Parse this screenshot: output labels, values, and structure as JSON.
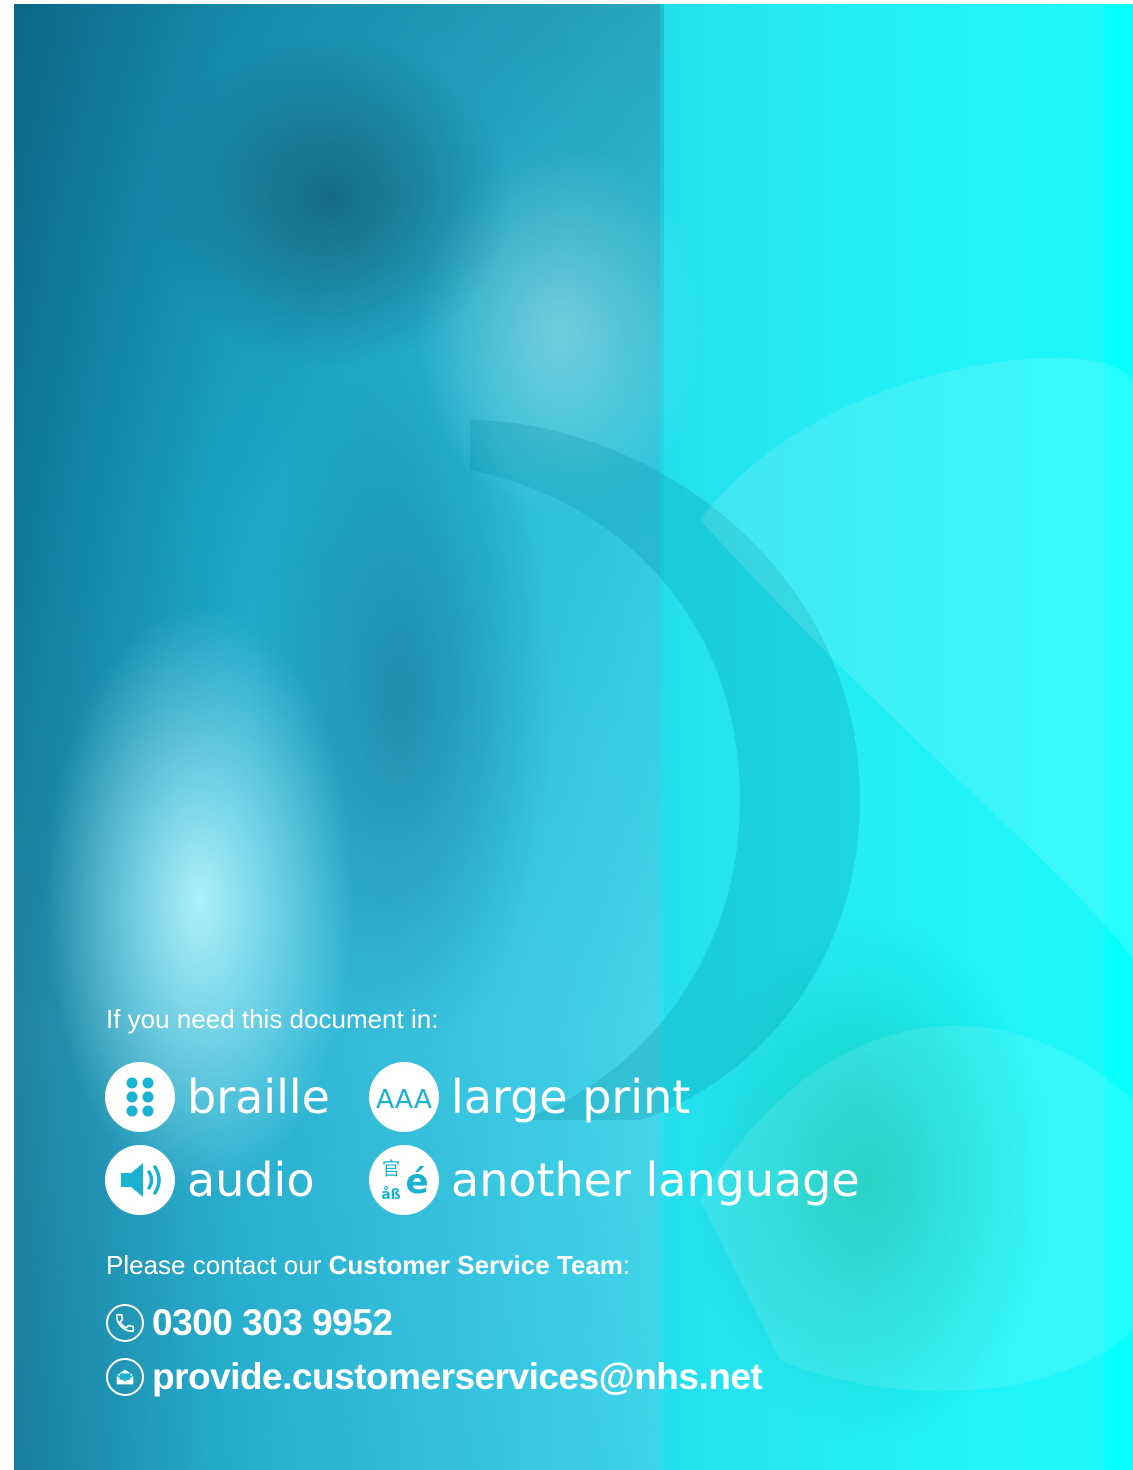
{
  "intro": "If you need this document in:",
  "formats": [
    {
      "label": "braille",
      "icon": "braille-icon"
    },
    {
      "label": "large print",
      "icon": "large-print-icon"
    },
    {
      "label": "audio",
      "icon": "audio-speaker-icon"
    },
    {
      "label": "another language",
      "icon": "language-icon"
    }
  ],
  "icon_text": {
    "large_print": "AAA",
    "language_top": "官",
    "language_bottom": "åß",
    "language_main": "é"
  },
  "contact": {
    "prefix": "Please contact our ",
    "team": "Customer Service Team",
    "suffix": ":",
    "phone": "0300 303 9952",
    "email": "provide.customerservices@nhs.net"
  },
  "colors": {
    "text": "#ffffff",
    "accent_cyan": "#00ffff",
    "icon_fill": "#19b3d1"
  }
}
